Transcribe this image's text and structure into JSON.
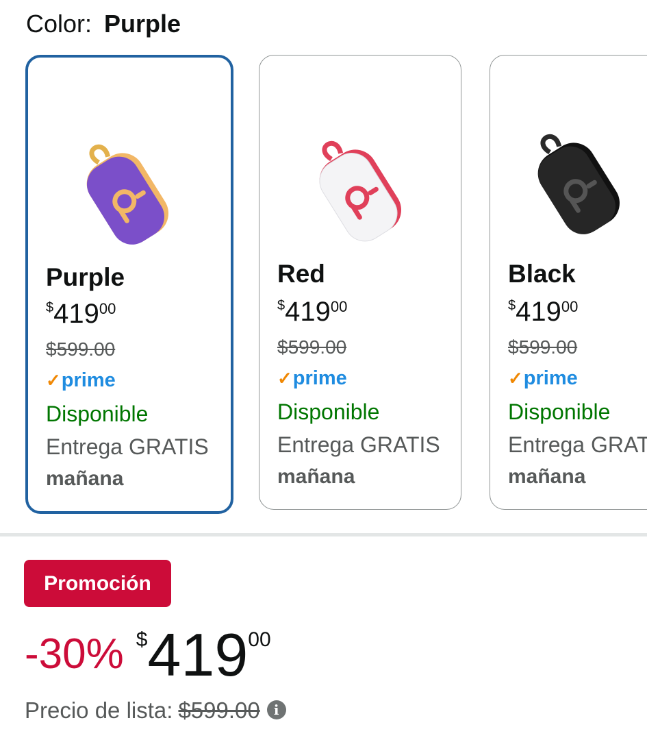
{
  "color_selector": {
    "label": "Color:",
    "selected": "Purple"
  },
  "variants": [
    {
      "name": "Purple",
      "currency": "$",
      "price_whole": "419",
      "price_fraction": "00",
      "list_price": "$599.00",
      "prime": "prime",
      "availability": "Disponible",
      "shipping": "Entrega GRATIS",
      "delivery_day": "mañana",
      "selected": true,
      "body_color": "#7b4fc9",
      "accent_color": "#f2b766"
    },
    {
      "name": "Red",
      "currency": "$",
      "price_whole": "419",
      "price_fraction": "00",
      "list_price": "$599.00",
      "prime": "prime",
      "availability": "Disponible",
      "shipping": "Entrega GRATIS",
      "delivery_day": "mañana",
      "selected": false,
      "body_color": "#f4f4f6",
      "accent_color": "#e0405a"
    },
    {
      "name": "Black",
      "currency": "$",
      "price_whole": "419",
      "price_fraction": "00",
      "list_price": "$599.00",
      "prime": "prime",
      "availability": "Disponible",
      "shipping": "Entrega GRATIS",
      "delivery_day": "mañana",
      "selected": false,
      "body_color": "#222222",
      "accent_color": "#3a3a3a"
    }
  ],
  "promotion": {
    "badge": "Promoción",
    "discount": "-30%",
    "currency": "$",
    "price_whole": "419",
    "price_fraction": "00",
    "list_label": "Precio de lista:",
    "list_price": "$599.00",
    "info_icon": "info-icon"
  },
  "colors": {
    "selected_border": "#2162a1",
    "promo_red": "#cc0c39",
    "prime_blue": "#1f8ce0",
    "available_green": "#007600"
  }
}
